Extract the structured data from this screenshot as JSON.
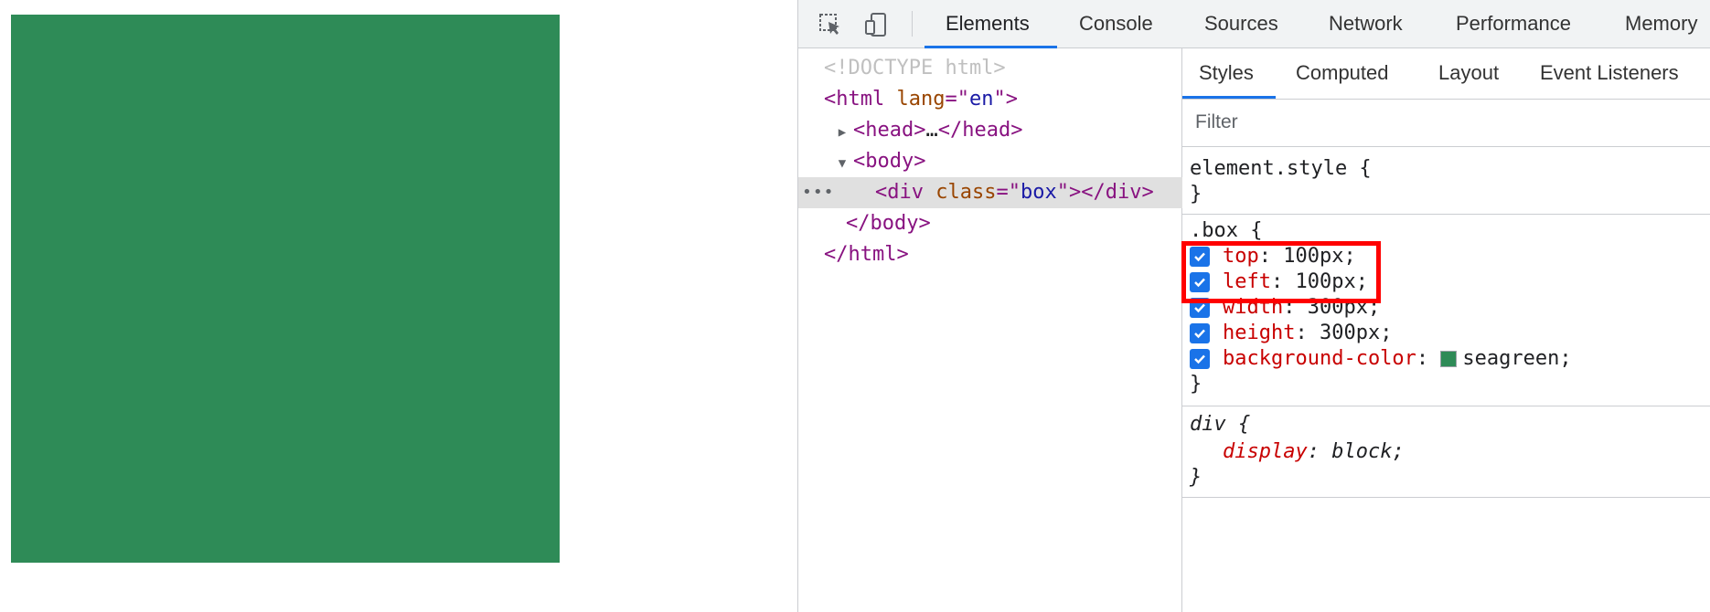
{
  "viewport": {
    "box_color": "#2e8b57"
  },
  "devtools": {
    "toolbar": {
      "icons": [
        "inspect-element-icon",
        "device-toolbar-icon"
      ],
      "tabs": [
        "Elements",
        "Console",
        "Sources",
        "Network",
        "Performance",
        "Memory"
      ],
      "active_tab": "Elements"
    },
    "dom": {
      "doctype": "<!DOCTYPE html>",
      "html_tag": "html",
      "html_attr": "lang",
      "html_attr_value": "en",
      "head_tag": "head",
      "head_ellipsis": "…",
      "body_tag": "body",
      "div_tag": "div",
      "div_attr": "class",
      "div_attr_value": "box",
      "selected_marker": "•••"
    },
    "styles": {
      "subtabs": [
        "Styles",
        "Computed",
        "Layout",
        "Event Listeners"
      ],
      "active_subtab": "Styles",
      "filter_placeholder": "Filter",
      "element_style_selector": "element.style {",
      "close_brace": "}",
      "box_rule": {
        "selector": ".box {",
        "properties": [
          {
            "name": "top",
            "value": "100px;"
          },
          {
            "name": "left",
            "value": "100px;"
          },
          {
            "name": "width",
            "value": "300px;"
          },
          {
            "name": "height",
            "value": "300px;"
          },
          {
            "name": "background-color",
            "value": "seagreen;"
          }
        ]
      },
      "div_rule": {
        "selector": "div {",
        "property_name": "display",
        "property_value": "block;"
      }
    },
    "accent_color": "#1a73e8",
    "highlight_color": "#ff0000"
  }
}
